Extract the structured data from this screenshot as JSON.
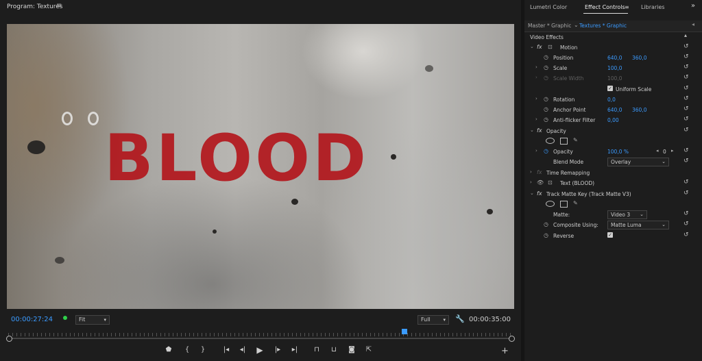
{
  "program_monitor": {
    "title": "Program: Textures",
    "menu_icon": "hamburger-icon",
    "frame_text": "BLOOD",
    "current_timecode": "00:00:27:24",
    "fit_label": "Fit",
    "quality_label": "Full",
    "end_timecode": "00:00:35:00",
    "playhead_progress": 0.785,
    "transport_icons": [
      "marker-icon",
      "mark-in-icon",
      "mark-out-icon",
      "go-to-in-icon",
      "step-back-icon",
      "play-icon",
      "step-forward-icon",
      "go-to-out-icon",
      "lift-icon",
      "extract-icon",
      "export-frame-icon",
      "comparison-view-icon",
      "add-button-icon"
    ]
  },
  "effect_controls": {
    "tabs": [
      "Lumetri Color",
      "Effect Controls",
      "Libraries"
    ],
    "active_tab": "Effect Controls",
    "more_label": "»",
    "source": "Master * Graphic",
    "clip": "Textures * Graphic",
    "section_label": "Video Effects",
    "motion": {
      "name": "Motion",
      "position_label": "Position",
      "position_x": "640,0",
      "position_y": "360,0",
      "scale_label": "Scale",
      "scale": "100,0",
      "scale_width_label": "Scale Width",
      "scale_width": "100,0",
      "uniform_label": "Uniform Scale",
      "rotation_label": "Rotation",
      "rotation": "0,0",
      "anchor_label": "Anchor Point",
      "anchor_x": "640,0",
      "anchor_y": "360,0",
      "antiflicker_label": "Anti-flicker Filter",
      "antiflicker": "0,00"
    },
    "opacity": {
      "name": "Opacity",
      "opacity_label": "Opacity",
      "opacity_value": "100,0 %",
      "keyframe_value": "0",
      "blend_label": "Blend Mode",
      "blend_value": "Overlay"
    },
    "time_remapping": "Time Remapping",
    "text_layer": "Text (BLOOD)",
    "track_matte": {
      "name": "Track Matte Key (Track Matte V3)",
      "matte_label": "Matte:",
      "matte_value": "Video 3",
      "composite_label": "Composite Using:",
      "composite_value": "Matte Luma",
      "reverse_label": "Reverse"
    },
    "accent_color": "#3b9bff"
  }
}
